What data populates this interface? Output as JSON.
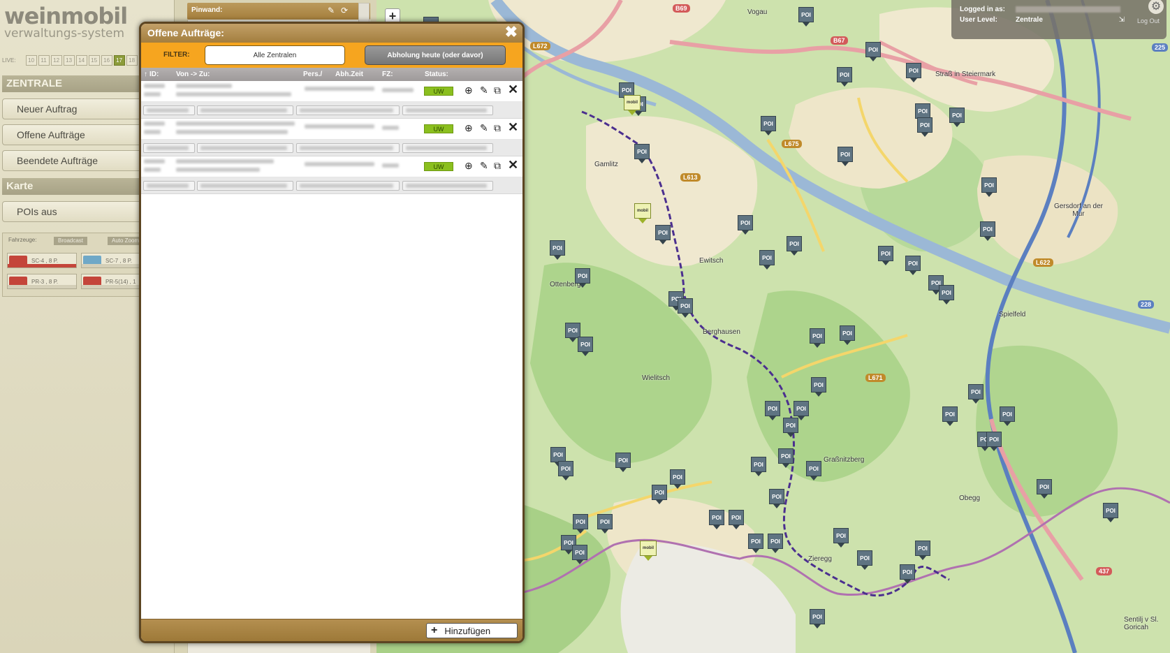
{
  "app": {
    "logo_line1": "weinmobil",
    "logo_line2": "verwaltungs-system"
  },
  "live": {
    "label": "LIVE:",
    "days": [
      "10",
      "11",
      "12",
      "13",
      "14",
      "15",
      "16",
      "17",
      "18"
    ],
    "active_day": "17"
  },
  "sidebar": {
    "section_zentrale": "ZENTRALE",
    "btn_new": "Neuer Auftrag",
    "btn_open": "Offene Aufträge",
    "btn_done": "Beendete Aufträge",
    "section_karte": "Karte",
    "btn_poi": "POIs aus",
    "fahrzeuge_label": "Fahrzeuge:",
    "broadcast": "Broadcast",
    "auto_zoom": "Auto Zoom",
    "vehicles": [
      {
        "label": "SC-4 , 8 P.",
        "color": "#c4453a"
      },
      {
        "label": "SC-7 , 8 P.",
        "color": "#6fa8c7"
      },
      {
        "label": "PR-3 , 8 P.",
        "color": "#c4453a"
      },
      {
        "label": "PR-5(14) , 1",
        "color": "#c4453a"
      }
    ]
  },
  "pinwand": {
    "title": "Pinwand:",
    "edit_icon": "pencil-icon",
    "refresh_icon": "refresh-icon"
  },
  "login": {
    "logged_in_label": "Logged in as:",
    "user_level_label": "User Level:",
    "user_level_value": "Zentrale",
    "logout": "Log Out"
  },
  "dialog": {
    "title": "Offene Aufträge:",
    "filter_label": "FILTER:",
    "filter_select": "Alle Zentralen",
    "filter_button": "Abholung heute (oder davor)",
    "columns": {
      "id": "ID:",
      "route": "Von -> Zu:",
      "pers": "Pers./",
      "abh": "Abh.Zeit",
      "fz": "FZ:",
      "status": "Status:"
    },
    "rows": [
      {
        "status": "UW"
      },
      {
        "status": "UW"
      },
      {
        "status": "UW"
      }
    ],
    "add_button": "Hinzufügen"
  },
  "map": {
    "poi_label": "POI",
    "mobil_label": "mobil",
    "places": [
      "Vogau",
      "Straß in Steiermark",
      "Gersdorf an der Mur",
      "Ewitsch",
      "Ottenberg",
      "Berghausen",
      "Spielfeld",
      "Wielitsch",
      "Obegg",
      "Zieregg",
      "Gamlitz",
      "Sentilj v Sl. Goricah",
      "Graßnitzberg"
    ],
    "roads": [
      "B69",
      "B67",
      "L672",
      "L675",
      "L613",
      "L622",
      "L671",
      "437",
      "225",
      "228"
    ]
  },
  "colors": {
    "accent": "#f6a51f",
    "dialog_header": "#a37e3e",
    "status_green": "#8bbf1f",
    "route_purple": "#4b2f8f"
  }
}
